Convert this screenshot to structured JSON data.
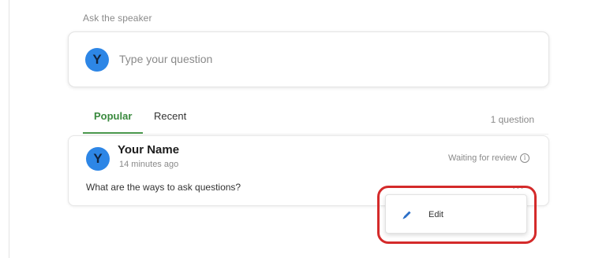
{
  "ask": {
    "heading": "Ask the speaker",
    "avatar_letter": "Y",
    "placeholder": "Type your question"
  },
  "tabs": [
    {
      "label": "Popular",
      "active": true
    },
    {
      "label": "Recent",
      "active": false
    }
  ],
  "question_count": "1 question",
  "question": {
    "avatar_letter": "Y",
    "author": "Your Name",
    "timestamp": "14 minutes ago",
    "status": "Waiting for review",
    "text": "What are the ways to ask questions?",
    "more_label": "•••"
  },
  "menu": {
    "edit_label": "Edit",
    "edit_icon": "pencil-icon"
  },
  "colors": {
    "accent_green": "#3a8a3e",
    "avatar_blue": "#2d86e6",
    "highlight_red": "#d42a2a"
  }
}
